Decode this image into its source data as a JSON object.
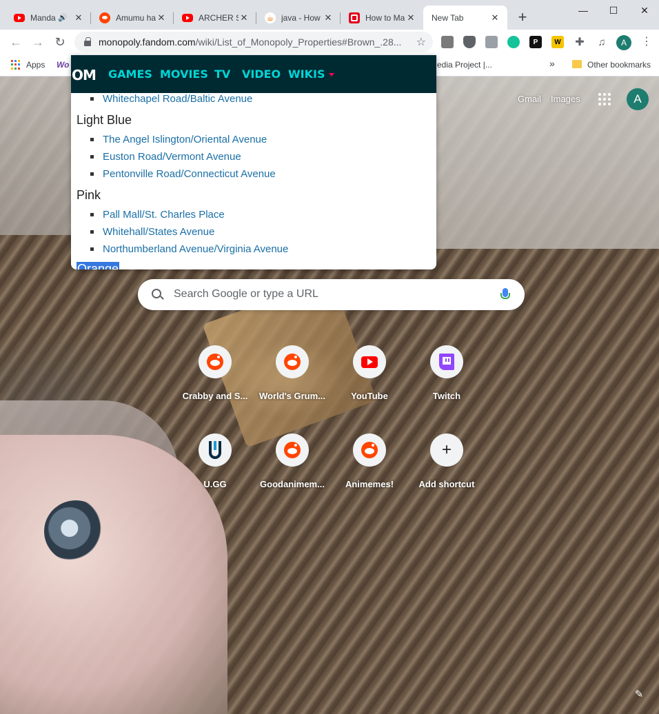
{
  "browser": {
    "tabs": [
      {
        "title": "Manda",
        "favicon": "youtube-icon",
        "audio": true
      },
      {
        "title": "Amumu ha",
        "favicon": "reddit-icon"
      },
      {
        "title": "ARCHER Se",
        "favicon": "youtube-icon"
      },
      {
        "title": "java - How",
        "favicon": "java-icon"
      },
      {
        "title": "How to Ma",
        "favicon": "opera-icon"
      },
      {
        "title": "New Tab",
        "active": true
      }
    ],
    "new_tab_label": "+",
    "window_controls": {
      "minimize": "—",
      "maximize": "☐",
      "close": "✕"
    },
    "url_host": "monopoly.fandom.com",
    "url_path": "/wiki/List_of_Monopoly_Properties#Brown_.28...",
    "profile_initial": "A"
  },
  "bookmarks": {
    "apps_label": "Apps",
    "wo_label": "Wo",
    "truncated_label": "edia Project |...",
    "overflow": "»",
    "other_label": "Other bookmarks"
  },
  "fandom": {
    "logo_fragment": "OM",
    "nav": [
      "GAMES",
      "MOVIES",
      "TV",
      "VIDEO",
      "WIKIS"
    ],
    "sections": [
      {
        "heading": null,
        "links": [
          "Whitechapel Road/Baltic Avenue"
        ]
      },
      {
        "heading": "Light Blue",
        "links": [
          "The Angel Islington/Oriental Avenue",
          "Euston Road/Vermont Avenue",
          "Pentonville Road/Connecticut Avenue"
        ]
      },
      {
        "heading": "Pink",
        "links": [
          "Pall Mall/St. Charles Place",
          "Whitehall/States Avenue",
          "Northumberland Avenue/Virginia Avenue"
        ]
      },
      {
        "heading": "Orange",
        "selected": true
      }
    ]
  },
  "ntp": {
    "gmail": "Gmail",
    "images": "Images",
    "avatar_initial": "A",
    "search_placeholder": "Search Google or type a URL",
    "shortcuts": [
      {
        "label": "Crabby and S...",
        "icon": "reddit-icon"
      },
      {
        "label": "World's Grum...",
        "icon": "reddit-icon"
      },
      {
        "label": "YouTube",
        "icon": "youtube-icon"
      },
      {
        "label": "Twitch",
        "icon": "twitch-icon"
      },
      {
        "label": "U.GG",
        "icon": "ugg-icon"
      },
      {
        "label": "Goodanimem...",
        "icon": "reddit-icon"
      },
      {
        "label": "Animemes!",
        "icon": "reddit-icon"
      },
      {
        "label": "Add shortcut",
        "icon": "plus-icon"
      }
    ],
    "edit_icon": "pencil-icon"
  },
  "colors": {
    "fandom_nav_bg": "#002a32",
    "fandom_nav_text": "#00d6d6",
    "link": "#1a6fa6",
    "selection": "#3477e0"
  }
}
